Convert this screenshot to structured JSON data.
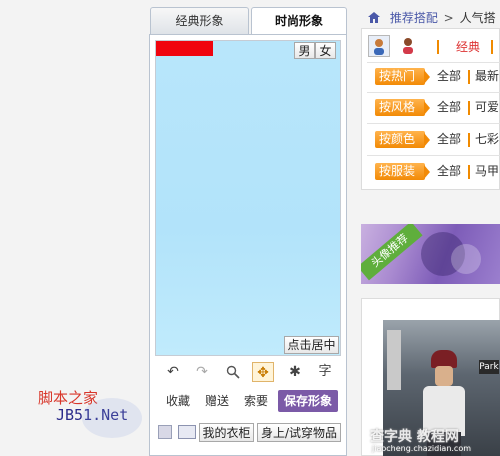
{
  "tabs": [
    "经典形象",
    "时尚形象"
  ],
  "gender": {
    "male": "男",
    "female": "女"
  },
  "center_button": "点击居中",
  "tools": {
    "undo": "↶",
    "redo": "↷",
    "zoom": "🔍",
    "move": "✥",
    "magic": "✱",
    "text": "字"
  },
  "actions": {
    "collect": "收藏",
    "gift": "赠送",
    "request": "索要",
    "save": "保存形象"
  },
  "bottom": {
    "wardrobe": "我的衣柜",
    "try_on": "身上/试穿物品"
  },
  "breadcrumb": {
    "home_icon": "house-icon",
    "link": "推荐搭配",
    "sep": ">",
    "current": "人气搭配"
  },
  "right_tabs": {
    "classic": "经典"
  },
  "filters": [
    {
      "tag": "按热门",
      "all": "全部",
      "next": "最新"
    },
    {
      "tag": "按风格",
      "all": "全部",
      "next": "可爱"
    },
    {
      "tag": "按颜色",
      "all": "全部",
      "next": "七彩"
    },
    {
      "tag": "按服装",
      "all": "全部",
      "next": "马甲"
    }
  ],
  "banner_text": "头像推荐",
  "watermark": {
    "cn": "脚本之家",
    "site": "JB51.Net",
    "right": "查字典 教程网",
    "right_url": "jiaocheng.chazidian.com"
  },
  "colors": {
    "accent": "#7b5aa7",
    "orange": "#f28a06",
    "red": "#f0040e",
    "canvas": "#b8e6fb"
  }
}
